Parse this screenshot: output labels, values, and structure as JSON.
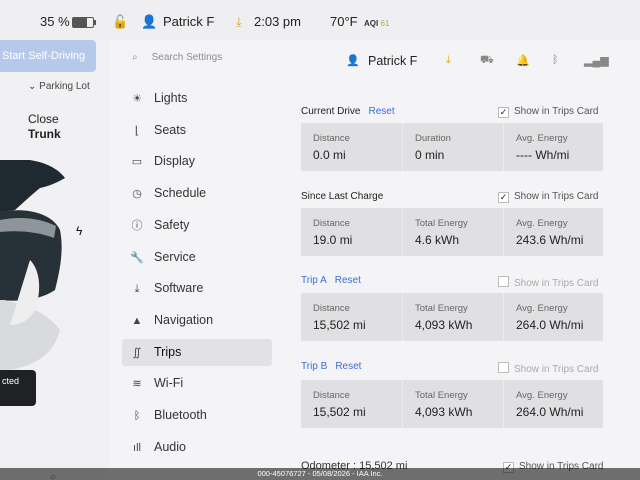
{
  "status": {
    "battery_pct": "35 %",
    "battery_level": 0.35,
    "user": "Patrick F",
    "time": "2:03 pm",
    "temp": "70°F",
    "aqi_label": "AQI",
    "aqi_value": "61"
  },
  "left": {
    "fsd_label": "Start Self-Driving",
    "parking_label": "Parking Lot",
    "close_label": "Close",
    "trunk_label": "Trunk",
    "connected_label": "cted"
  },
  "menu": {
    "search_placeholder": "Search Settings",
    "items": [
      {
        "label": "Lights",
        "icon": "lights-icon"
      },
      {
        "label": "Seats",
        "icon": "seat-icon"
      },
      {
        "label": "Display",
        "icon": "display-icon"
      },
      {
        "label": "Schedule",
        "icon": "schedule-icon"
      },
      {
        "label": "Safety",
        "icon": "safety-icon"
      },
      {
        "label": "Service",
        "icon": "wrench-icon"
      },
      {
        "label": "Software",
        "icon": "download-icon"
      },
      {
        "label": "Navigation",
        "icon": "navigation-icon"
      },
      {
        "label": "Trips",
        "icon": "trips-icon"
      },
      {
        "label": "Wi-Fi",
        "icon": "wifi-icon"
      },
      {
        "label": "Bluetooth",
        "icon": "bluetooth-icon"
      },
      {
        "label": "Audio",
        "icon": "audio-icon"
      }
    ],
    "active": "Trips"
  },
  "header": {
    "user": "Patrick F"
  },
  "sections": {
    "current": {
      "title": "Current Drive",
      "reset": "Reset",
      "show": "Show in Trips Card",
      "checked": true,
      "cells": [
        {
          "label": "Distance",
          "value": "0.0 mi"
        },
        {
          "label": "Duration",
          "value": "0 min"
        },
        {
          "label": "Avg. Energy",
          "value": "---- Wh/mi"
        }
      ]
    },
    "since": {
      "title": "Since Last Charge",
      "show": "Show in Trips Card",
      "checked": true,
      "cells": [
        {
          "label": "Distance",
          "value": "19.0 mi"
        },
        {
          "label": "Total Energy",
          "value": "4.6 kWh"
        },
        {
          "label": "Avg. Energy",
          "value": "243.6 Wh/mi"
        }
      ]
    },
    "tripa": {
      "title": "Trip A",
      "reset": "Reset",
      "show": "Show in Trips Card",
      "checked": false,
      "cells": [
        {
          "label": "Distance",
          "value": "15,502 mi"
        },
        {
          "label": "Total Energy",
          "value": "4,093 kWh"
        },
        {
          "label": "Avg. Energy",
          "value": "264.0 Wh/mi"
        }
      ]
    },
    "tripb": {
      "title": "Trip B",
      "reset": "Reset",
      "show": "Show in Trips Card",
      "checked": false,
      "cells": [
        {
          "label": "Distance",
          "value": "15,502 mi"
        },
        {
          "label": "Total Energy",
          "value": "4,093 kWh"
        },
        {
          "label": "Avg. Energy",
          "value": "264.0 Wh/mi"
        }
      ]
    }
  },
  "odometer": {
    "label": "Odometer :",
    "value": "15,502 mi",
    "show": "Show in Trips Card",
    "checked": true
  },
  "watermark": "000-45076727 - 05/08/2026 - IAA Inc."
}
